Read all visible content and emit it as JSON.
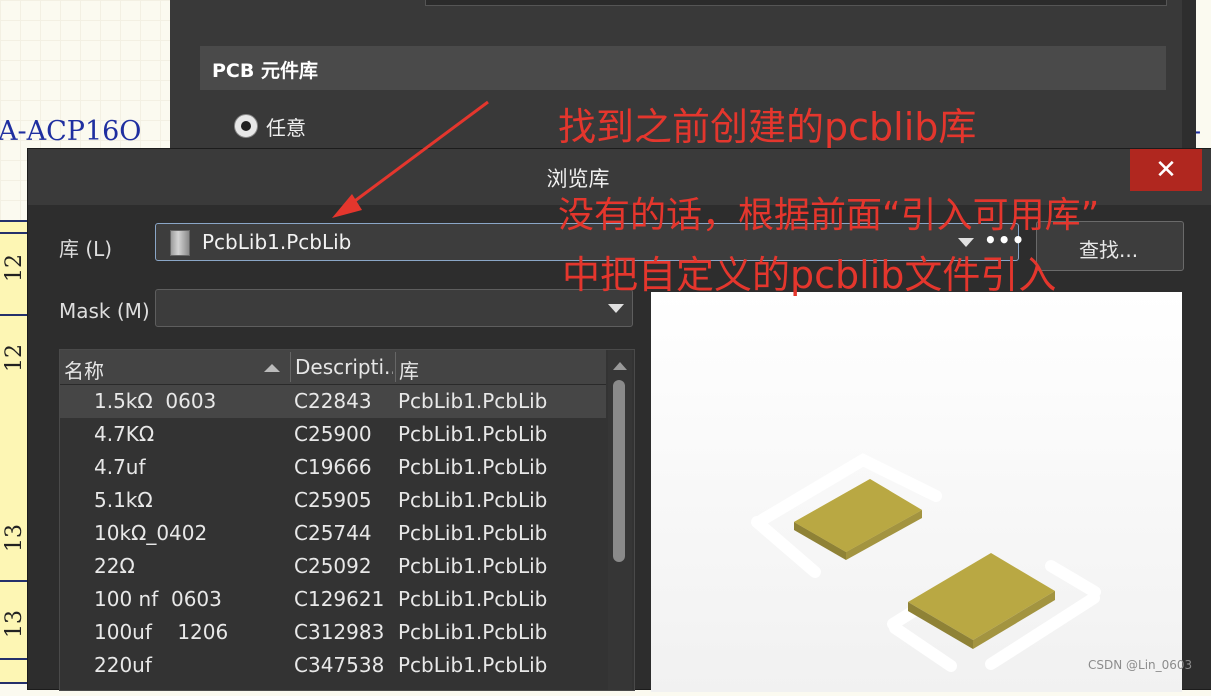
{
  "background": {
    "part_name": "A-ACP16O",
    "part_name_right": "-A",
    "pins": [
      "12",
      "12",
      "13",
      "13"
    ],
    "panel_section_title": "PCB 元件库",
    "radio_label": "任意"
  },
  "dialog": {
    "title": "浏览库",
    "close_glyph": "✕",
    "library_label": "库 (L)",
    "library_value": "PcbLib1.PcbLib",
    "more_glyph": "•••",
    "find_button": "查找...",
    "mask_label": "Mask (M)",
    "mask_value": "",
    "columns": [
      "名称",
      "Descripti...",
      "库"
    ],
    "rows": [
      {
        "name": "1.5kΩ  0603",
        "description": "C22843",
        "library": "PcbLib1.PcbLib",
        "selected": true
      },
      {
        "name": "4.7KΩ",
        "description": "C25900",
        "library": "PcbLib1.PcbLib"
      },
      {
        "name": "4.7uf",
        "description": "C19666",
        "library": "PcbLib1.PcbLib"
      },
      {
        "name": "5.1kΩ",
        "description": "C25905",
        "library": "PcbLib1.PcbLib"
      },
      {
        "name": "10kΩ_0402",
        "description": "C25744",
        "library": "PcbLib1.PcbLib"
      },
      {
        "name": "22Ω",
        "description": "C25092",
        "library": "PcbLib1.PcbLib"
      },
      {
        "name": "100 nf  0603",
        "description": "C129621",
        "library": "PcbLib1.PcbLib"
      },
      {
        "name": "100uf    1206",
        "description": "C312983",
        "library": "PcbLib1.PcbLib"
      },
      {
        "name": "220uf",
        "description": "C347538",
        "library": "PcbLib1.PcbLib"
      }
    ]
  },
  "annotations": {
    "line1": "找到之前创建的pcblib库",
    "line2": "没有的话，根据前面“引入可用库”",
    "line3": "中把自定义的pcblib文件引入"
  },
  "colors": {
    "annotation": "#e4362d",
    "pad": "#b9a843",
    "close_button": "#b0271f"
  },
  "watermark": "CSDN @Lin_0603"
}
